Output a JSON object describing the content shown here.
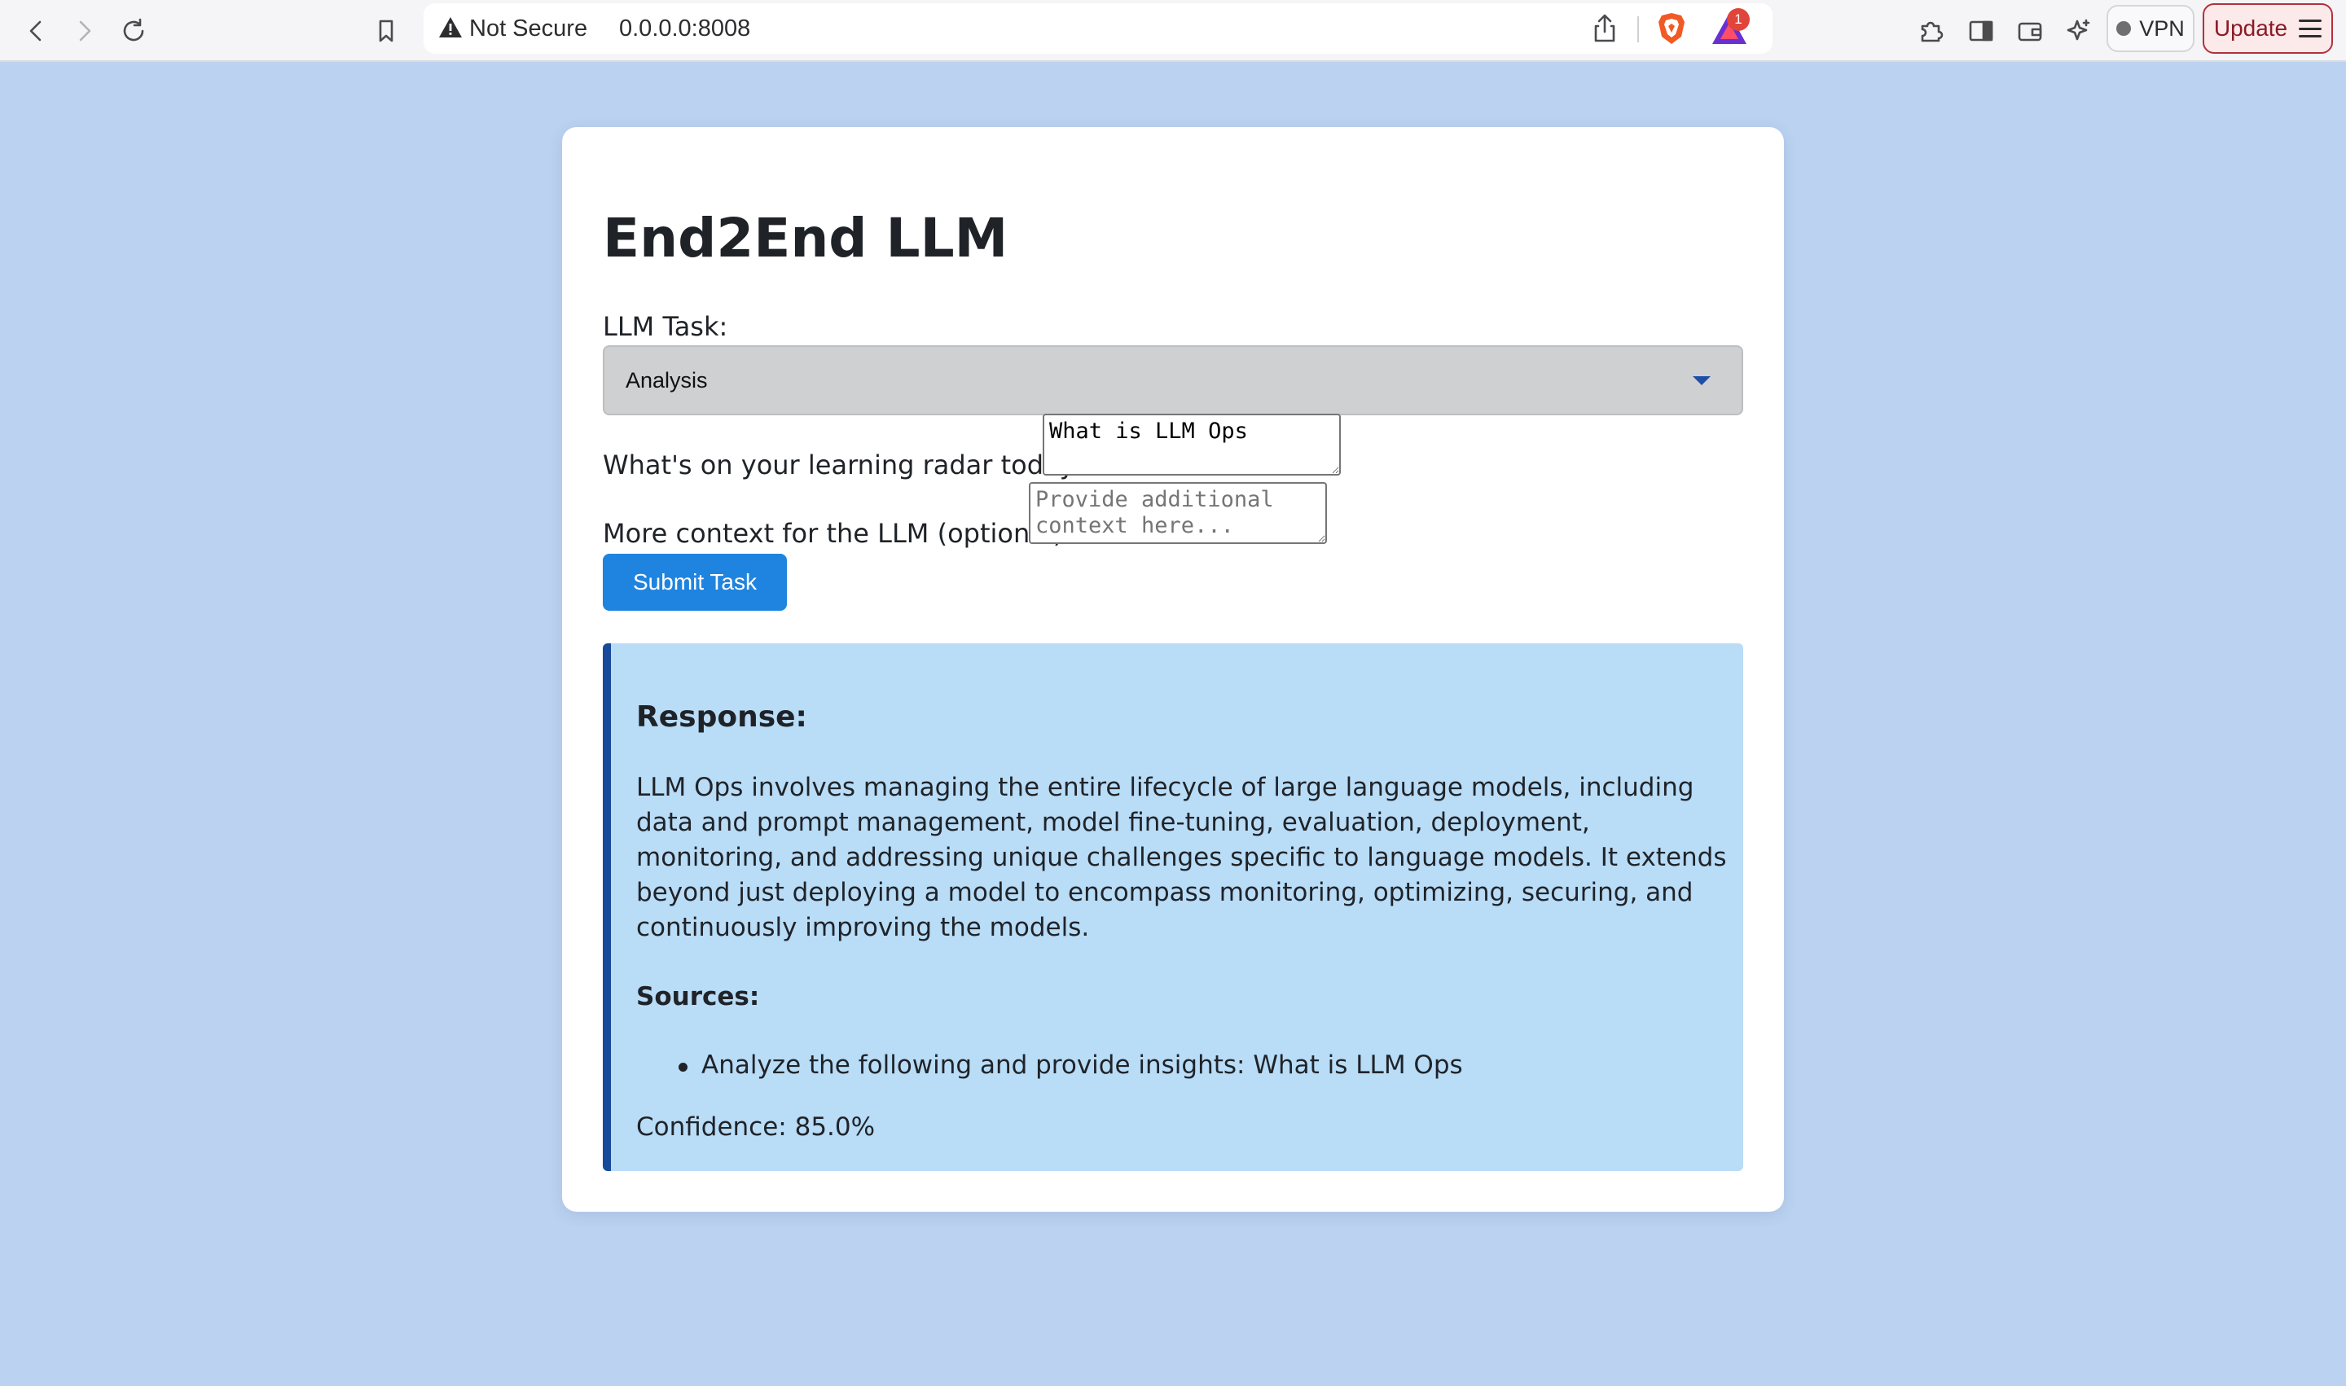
{
  "browser": {
    "security_label": "Not Secure",
    "url": "0.0.0.0:8008",
    "rewards_badge_count": "1",
    "vpn_label": "VPN",
    "update_label": "Update",
    "icons": [
      "back-icon",
      "forward-icon",
      "reload-icon",
      "bookmark-icon",
      "warning-icon",
      "share-icon",
      "brave-shield-icon",
      "brave-rewards-icon",
      "extensions-icon",
      "sidebar-icon",
      "wallet-icon",
      "leo-ai-icon",
      "menu-icon"
    ]
  },
  "page": {
    "title": "End2End LLM",
    "task": {
      "label": "LLM Task:",
      "selected": "Analysis"
    },
    "question": {
      "label": "What's on your learning radar today?",
      "value": "What is LLM Ops"
    },
    "context": {
      "label": "More context for the LLM (optional):",
      "placeholder": "Provide additional context here..."
    },
    "submit_label": "Submit Task",
    "response": {
      "heading": "Response:",
      "text": "LLM Ops involves managing the entire lifecycle of large language models, including data and prompt management, model fine-tuning, evaluation, deployment, monitoring, and addressing unique challenges specific to language models. It extends beyond just deploying a model to encompass monitoring, optimizing, securing, and continuously improving the models.",
      "sources_heading": "Sources:",
      "sources": [
        "Analyze the following and provide insights: What is LLM Ops"
      ],
      "confidence": "Confidence: 85.0%"
    }
  },
  "colors": {
    "page_background": "#bbd3f1",
    "submit_button": "#1f84e0",
    "response_background": "#b9dcf7",
    "response_accent": "#174a9a",
    "update_button_border": "#b1313c"
  }
}
